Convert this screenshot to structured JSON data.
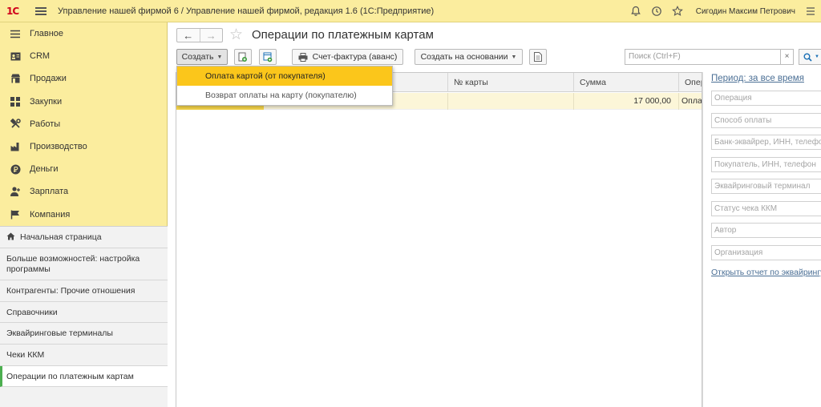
{
  "titlebar": {
    "logo": "1С",
    "title": "Управление нашей фирмой 6 / Управление нашей фирмой, редакция 1.6  (1С:Предприятие)",
    "user": "Сигодин Максим Петрович"
  },
  "sidebar": {
    "sections": [
      {
        "label": "Главное",
        "icon": "menu-lines-icon"
      },
      {
        "label": "CRM",
        "icon": "contact-card-icon"
      },
      {
        "label": "Продажи",
        "icon": "shop-icon"
      },
      {
        "label": "Закупки",
        "icon": "purchases-icon"
      },
      {
        "label": "Работы",
        "icon": "tools-icon"
      },
      {
        "label": "Производство",
        "icon": "factory-icon"
      },
      {
        "label": "Деньги",
        "icon": "ruble-coin-icon"
      },
      {
        "label": "Зарплата",
        "icon": "person-icon"
      },
      {
        "label": "Компания",
        "icon": "flag-icon"
      }
    ],
    "open_windows": [
      {
        "label": "Начальная страница"
      },
      {
        "label": "Больше возможностей: настройка программы"
      },
      {
        "label": "Контрагенты: Прочие отношения"
      },
      {
        "label": "Справочники"
      },
      {
        "label": "Эквайринговые терминалы"
      },
      {
        "label": "Чеки ККМ"
      },
      {
        "label": "Операции по платежным картам"
      }
    ]
  },
  "main": {
    "title": "Операции по платежным картам",
    "toolbar": {
      "create_label": "Создать",
      "invoice_label": "Счет-фактура (аванс)",
      "create_based_label": "Создать на основании"
    },
    "search": {
      "placeholder": "Поиск (Ctrl+F)",
      "clear": "×"
    },
    "dropdown": {
      "items": [
        "Оплата картой (от покупателя)",
        "Возврат оплаты на карту (покупателю)"
      ]
    },
    "table": {
      "columns": [
        "№ карты",
        "Сумма",
        "Операция"
      ],
      "rows": [
        {
          "card": "",
          "amount": "17 000,00",
          "operation": "Оплата"
        }
      ]
    },
    "filters": {
      "period": "Период: за все время",
      "fields": [
        "Операция",
        "Способ оплаты",
        "Банк-эквайрер, ИНН, телефон",
        "Покупатель, ИНН, телефон",
        "Эквайринговый терминал",
        "Статус чека ККМ",
        "Автор",
        "Организация"
      ],
      "report_link": "Открыть отчет по эквайрингу"
    }
  },
  "colors": {
    "panel_yellow": "#fbed9e",
    "menu_highlight": "#fbc61b",
    "row_selected": "#fcf6d8",
    "link": "#4b6f95",
    "active_marker": "#4caf50"
  }
}
